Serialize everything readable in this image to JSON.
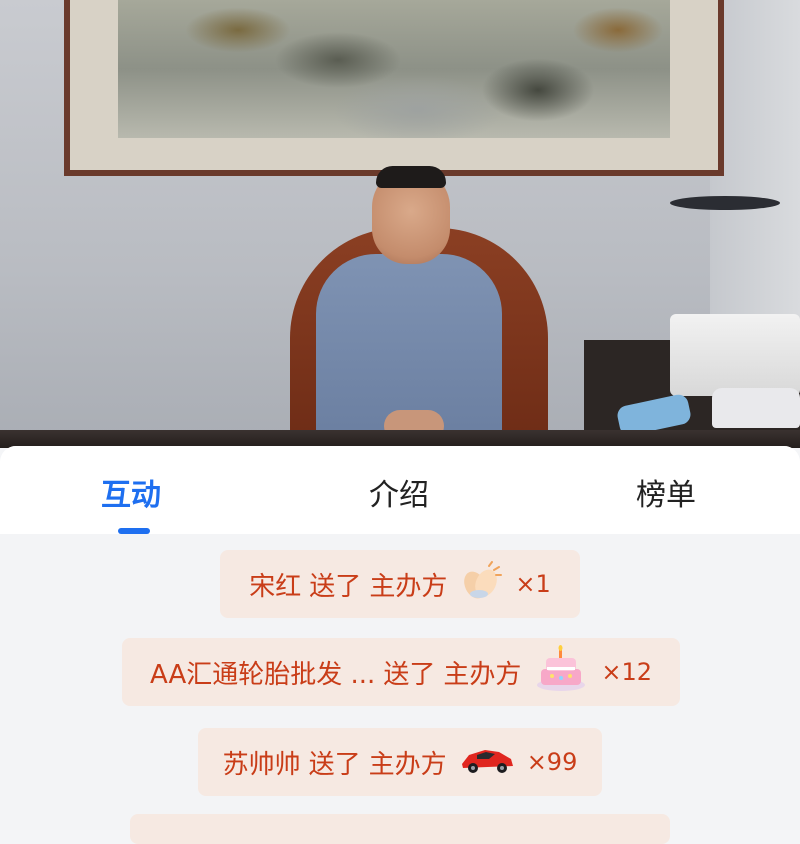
{
  "tabs": [
    {
      "label": "互动",
      "active": true
    },
    {
      "label": "介绍",
      "active": false
    },
    {
      "label": "榜单",
      "active": false
    }
  ],
  "messages": [
    {
      "sender": "宋红",
      "action": "送了",
      "target": "主办方",
      "gift_icon": "clapping-hands-icon",
      "count": "×1"
    },
    {
      "sender": "AA汇通轮胎批发 ...",
      "action": "送了",
      "target": "主办方",
      "gift_icon": "birthday-cake-icon",
      "count": "×12"
    },
    {
      "sender": "苏帅帅",
      "action": "送了",
      "target": "主办方",
      "gift_icon": "sports-car-icon",
      "count": "×99"
    }
  ],
  "colors": {
    "accent": "#1e6ff0",
    "message_bg": "#f6e9e2",
    "message_text": "#c93d18"
  }
}
